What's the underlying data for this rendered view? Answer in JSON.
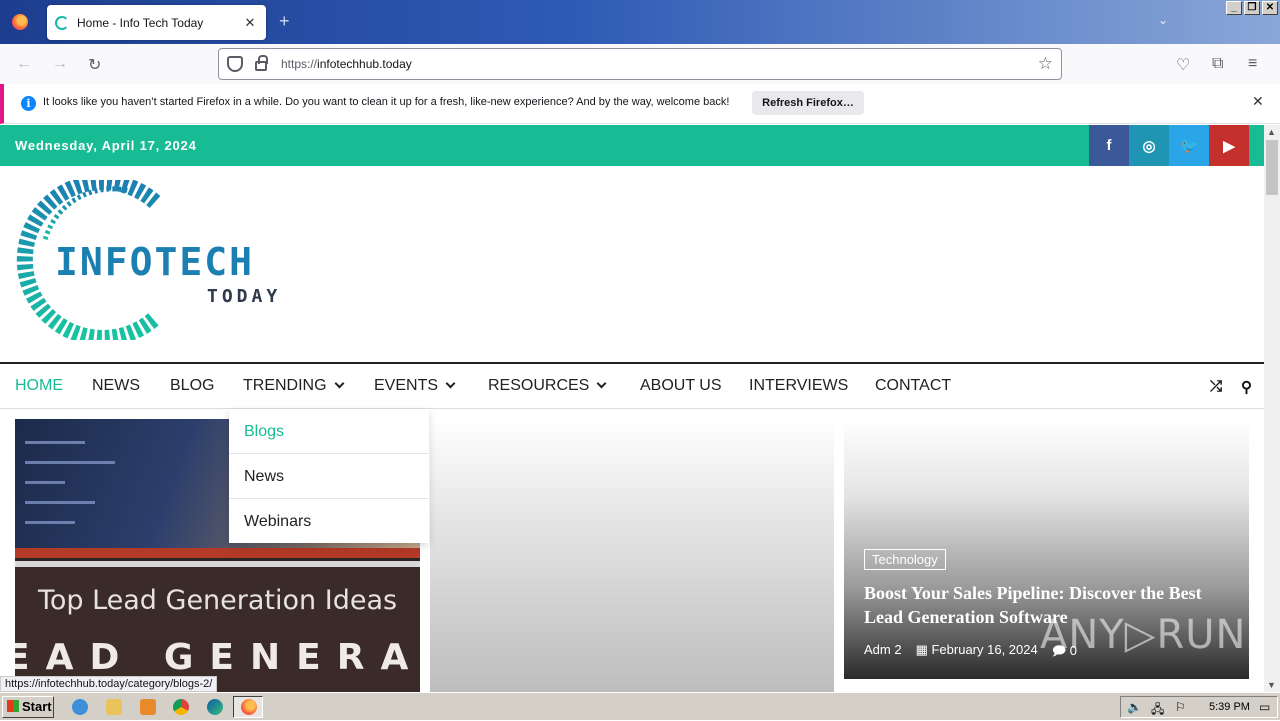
{
  "browser": {
    "tab_title": "Home - Info Tech Today",
    "url_host": "infotechhub.today",
    "url_prefix": "https://",
    "notification_text": "It looks like you haven’t started Firefox in a while. Do you want to clean it up for a fresh, like-new experience? And by the way, welcome back!",
    "notification_button": "Refresh Firefox…",
    "status_url": "https://infotechhub.today/category/blogs-2/"
  },
  "site": {
    "date": "Wednesday, April 17, 2024",
    "social": [
      {
        "name": "facebook-icon",
        "glyph": "f",
        "color": "#3b5998"
      },
      {
        "name": "instagram-icon",
        "glyph": "◎",
        "color": "#1f95b3"
      },
      {
        "name": "twitter-icon",
        "glyph": "🐦",
        "color": "#29a5e8"
      },
      {
        "name": "youtube-icon",
        "glyph": "▶",
        "color": "#c4302b"
      }
    ],
    "logo_title": "INFOTECH",
    "logo_sub": "TODAY",
    "accent": "#17bc94"
  },
  "menu": {
    "home": "HOME",
    "news": "NEWS",
    "blog": "BLOG",
    "trending": "TRENDING",
    "events": "EVENTS",
    "resources": "RESOURCES",
    "about": "ABOUT US",
    "interviews": "INTERVIEWS",
    "contact": "CONTACT"
  },
  "dropdown": [
    "Blogs",
    "News",
    "Webinars"
  ],
  "card1": {
    "title": "Top Lead Generation Ideas",
    "big_text": "EAD GENERATIO"
  },
  "card3": {
    "tag": "Technology",
    "title": "Boost Your Sales Pipeline: Discover the Best Lead Generation Software",
    "author": "Adm 2",
    "date": "February 16, 2024",
    "comments": "0"
  },
  "watermark": "ANY▷RUN",
  "taskbar": {
    "start": "Start",
    "clock": "5:39 PM"
  }
}
